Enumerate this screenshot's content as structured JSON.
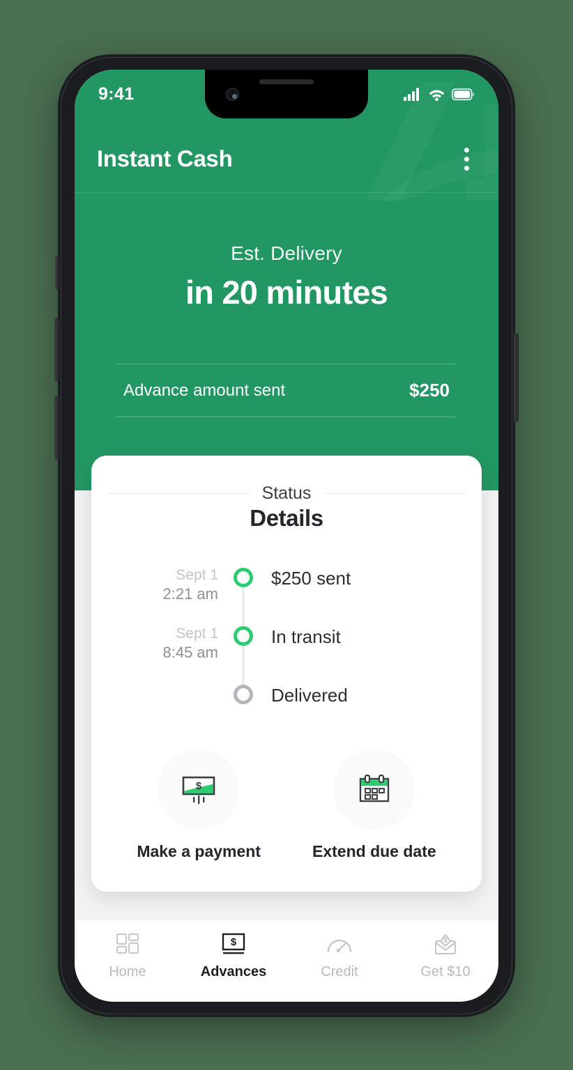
{
  "status_bar": {
    "time": "9:41",
    "signal_icon": "cellular-signal-icon",
    "wifi_icon": "wifi-icon",
    "battery_icon": "battery-full-icon"
  },
  "app_bar": {
    "title": "Instant Cash",
    "menu_icon": "kebab-menu-icon"
  },
  "hero": {
    "label": "Est. Delivery",
    "value": "in 20 minutes"
  },
  "summary": {
    "label": "Advance amount sent",
    "value": "$250"
  },
  "details_card": {
    "eyebrow": "Status",
    "heading": "Details",
    "timeline": [
      {
        "date": "Sept 1",
        "time": "2:21 am",
        "label": "$250 sent",
        "state": "done"
      },
      {
        "date": "Sept 1",
        "time": "8:45 am",
        "label": "In transit",
        "state": "done"
      },
      {
        "date": "",
        "time": "",
        "label": "Delivered",
        "state": "pending"
      }
    ],
    "actions": [
      {
        "label": "Make a payment",
        "icon": "cash-bill-icon"
      },
      {
        "label": "Extend due date",
        "icon": "calendar-icon"
      }
    ]
  },
  "bottom_nav": [
    {
      "label": "Home",
      "icon": "grid-icon",
      "active": false
    },
    {
      "label": "Advances",
      "icon": "dollar-card-icon",
      "active": true
    },
    {
      "label": "Credit",
      "icon": "speedometer-icon",
      "active": false
    },
    {
      "label": "Get $10",
      "icon": "envelope-dollar-icon",
      "active": false
    }
  ],
  "colors": {
    "brand_green": "#239763",
    "accent_green": "#2ecc71",
    "pending_gray": "#b3b6ba",
    "page_background": "#4a6e50"
  }
}
